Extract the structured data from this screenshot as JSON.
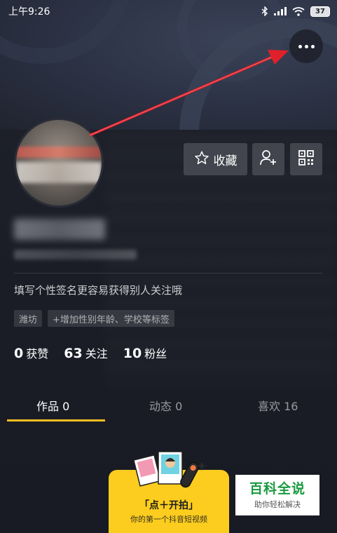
{
  "status_bar": {
    "time": "上午9:26",
    "battery": "37"
  },
  "profile": {
    "favorite_label": "收藏",
    "bio": "填写个性签名更容易获得别人关注哦",
    "tags": [
      "潍坊",
      "+增加性别年龄、学校等标签"
    ],
    "stats": [
      {
        "count": "0",
        "label": "获赞"
      },
      {
        "count": "63",
        "label": "关注"
      },
      {
        "count": "10",
        "label": "粉丝"
      }
    ]
  },
  "tabs": [
    {
      "label": "作品 0",
      "active": true
    },
    {
      "label": "动态 0",
      "active": false
    },
    {
      "label": "喜欢 16",
      "active": false
    }
  ],
  "shoot_card": {
    "title": "「点＋开拍」",
    "subtitle": "你的第一个抖音短视频"
  },
  "watermark": {
    "title": "百科全说",
    "subtitle": "助你轻松解决"
  },
  "colors": {
    "accent": "#fbbf21",
    "background": "#161823",
    "annotation_arrow": "#e0202a"
  },
  "icons": [
    "bluetooth-icon",
    "signal-icon",
    "wifi-icon",
    "battery-icon",
    "more-icon",
    "star-icon",
    "add-friend-icon",
    "qr-code-icon"
  ]
}
